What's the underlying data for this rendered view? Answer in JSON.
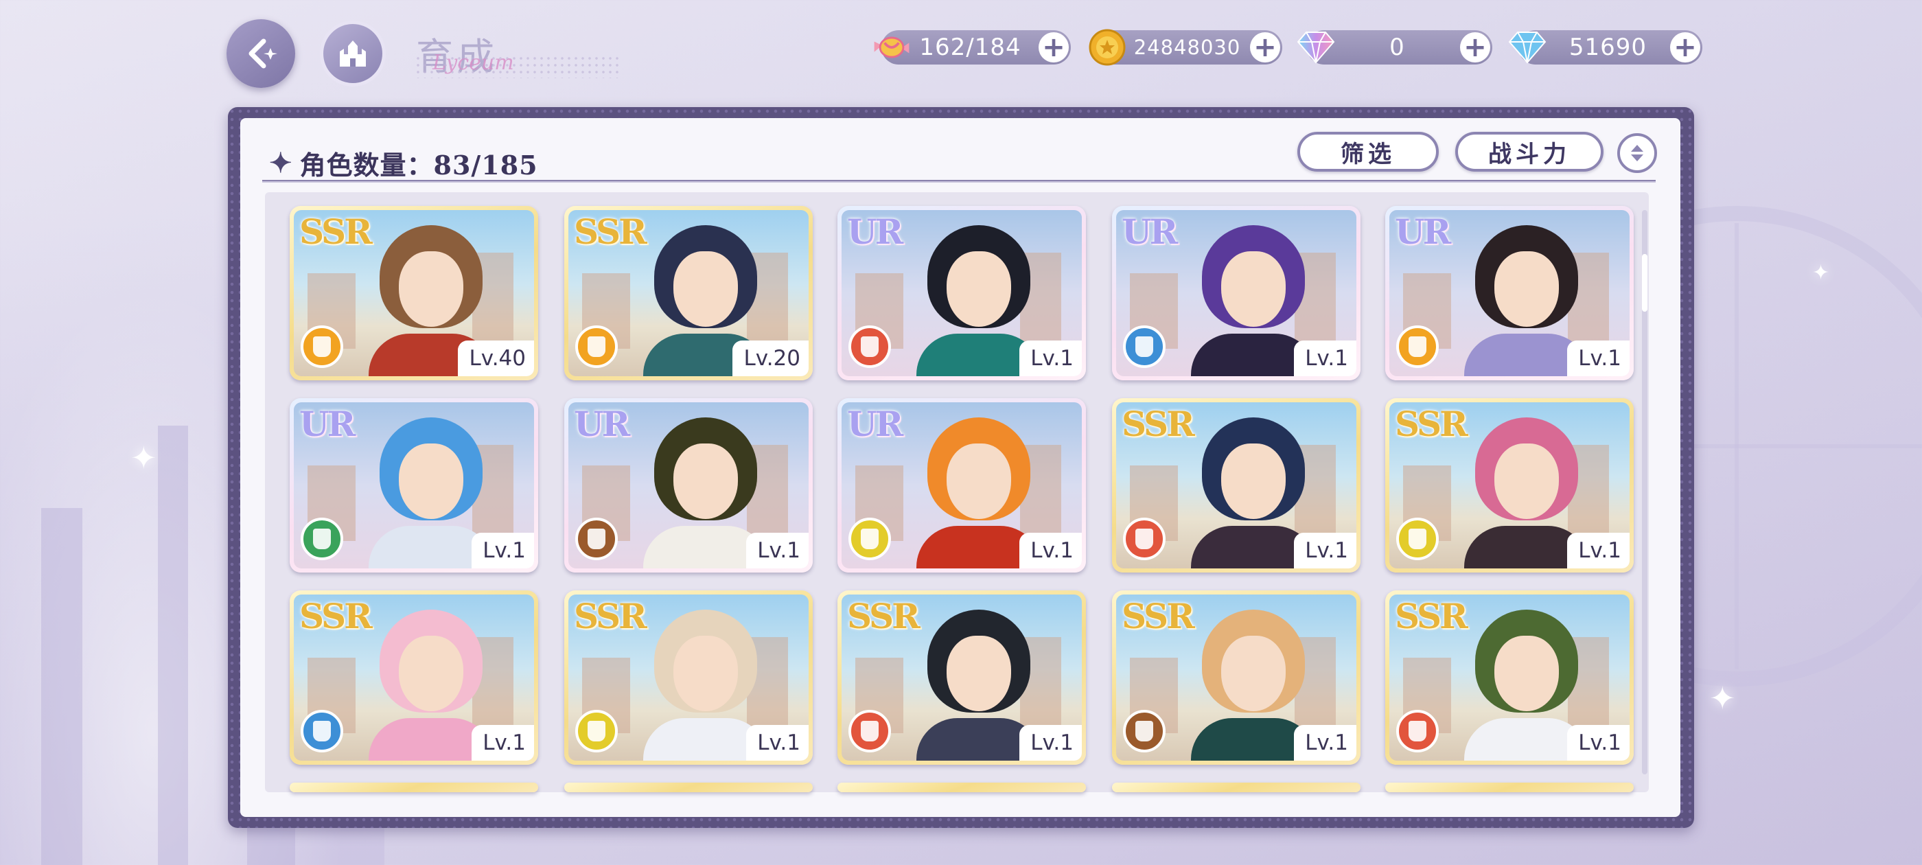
{
  "header": {
    "title": "育成",
    "title_script": "Lyceum"
  },
  "resources": [
    {
      "name": "candy",
      "value": "162/184",
      "icon": "candy-icon",
      "color": "#e86a8c"
    },
    {
      "name": "gold",
      "value": "24848030",
      "icon": "gold-coin-icon",
      "color": "#f0b02a"
    },
    {
      "name": "rainbow-gem",
      "value": "0",
      "icon": "rainbow-diamond-icon",
      "color": "#c68ee8"
    },
    {
      "name": "diamond",
      "value": "51690",
      "icon": "blue-diamond-icon",
      "color": "#6fc4f0"
    }
  ],
  "panel": {
    "count_label": "角色数量：83/185",
    "filter_label": "筛选",
    "sort_label": "战斗力"
  },
  "cards": [
    {
      "rarity": "SSR",
      "level": "Lv.40",
      "attr_color": "#f2a321",
      "hair": "#8b5e3c",
      "outfit": "#b83a2a"
    },
    {
      "rarity": "SSR",
      "level": "Lv.20",
      "attr_color": "#f2a321",
      "hair": "#2a3150",
      "outfit": "#2f6b6f"
    },
    {
      "rarity": "UR",
      "level": "Lv.1",
      "attr_color": "#e2553d",
      "hair": "#1d1f2a",
      "outfit": "#1f7f78"
    },
    {
      "rarity": "UR",
      "level": "Lv.1",
      "attr_color": "#3d8fd6",
      "hair": "#5a3a9a",
      "outfit": "#2a2340"
    },
    {
      "rarity": "UR",
      "level": "Lv.1",
      "attr_color": "#f2a321",
      "hair": "#2b2124",
      "outfit": "#9b93d0"
    },
    {
      "rarity": "UR",
      "level": "Lv.1",
      "attr_color": "#3aa35b",
      "hair": "#4a9be0",
      "outfit": "#dfe6f2"
    },
    {
      "rarity": "UR",
      "level": "Lv.1",
      "attr_color": "#9a5a2c",
      "hair": "#3a3a1e",
      "outfit": "#f1eee8"
    },
    {
      "rarity": "UR",
      "level": "Lv.1",
      "attr_color": "#e3cc2a",
      "hair": "#f08a2a",
      "outfit": "#c8321f"
    },
    {
      "rarity": "SSR",
      "level": "Lv.1",
      "attr_color": "#e2553d",
      "hair": "#233258",
      "outfit": "#3a2c3c"
    },
    {
      "rarity": "SSR",
      "level": "Lv.1",
      "attr_color": "#e3cc2a",
      "hair": "#d86a94",
      "outfit": "#3a2c34"
    },
    {
      "rarity": "SSR",
      "level": "Lv.1",
      "attr_color": "#3d8fd6",
      "hair": "#f4bcd0",
      "outfit": "#f0a8c8"
    },
    {
      "rarity": "SSR",
      "level": "Lv.1",
      "attr_color": "#e3cc2a",
      "hair": "#e6d4bc",
      "outfit": "#eef0f6"
    },
    {
      "rarity": "SSR",
      "level": "Lv.1",
      "attr_color": "#e2553d",
      "hair": "#22262e",
      "outfit": "#3b3f58"
    },
    {
      "rarity": "SSR",
      "level": "Lv.1",
      "attr_color": "#9a5a2c",
      "hair": "#e4b27a",
      "outfit": "#1f4a48"
    },
    {
      "rarity": "SSR",
      "level": "Lv.1",
      "attr_color": "#e2553d",
      "hair": "#4d6a32",
      "outfit": "#f1f2f6"
    }
  ]
}
